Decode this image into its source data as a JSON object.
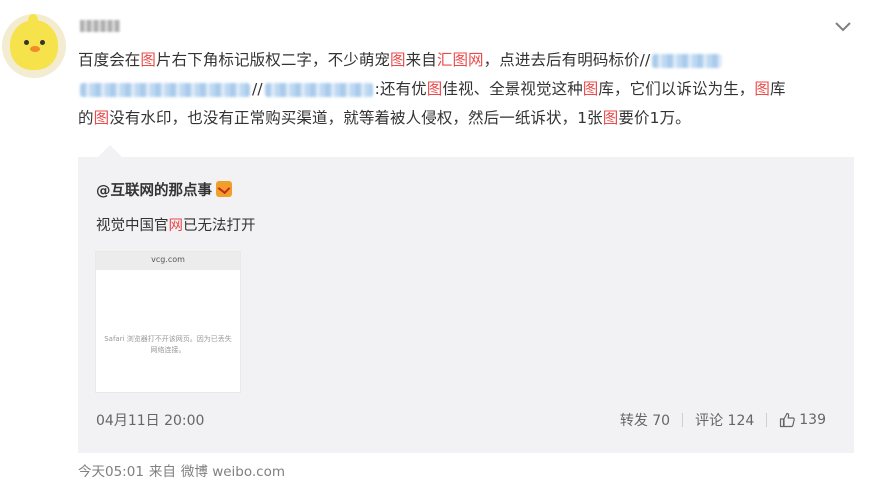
{
  "post": {
    "segments": [
      {
        "t": "百度会在",
        "hl": false
      },
      {
        "t": "图",
        "hl": true
      },
      {
        "t": "片右下角标记版权二字，不少萌宠",
        "hl": false
      },
      {
        "t": "图",
        "hl": true
      },
      {
        "t": "来自",
        "hl": false
      },
      {
        "t": "汇图网",
        "hl": true
      },
      {
        "t": "，点进去后有明码标价//",
        "hl": false
      }
    ],
    "segments2": [
      {
        "t": "//",
        "hl": false
      }
    ],
    "segments3": [
      {
        "t": ":还有优",
        "hl": false
      },
      {
        "t": "图",
        "hl": true
      },
      {
        "t": "佳视、全景视觉这种",
        "hl": false
      },
      {
        "t": "图",
        "hl": true
      },
      {
        "t": "库，它们以诉讼为生，",
        "hl": false
      },
      {
        "t": "图",
        "hl": true
      },
      {
        "t": "库",
        "hl": false
      }
    ],
    "segments4": [
      {
        "t": "的",
        "hl": false
      },
      {
        "t": "图",
        "hl": true
      },
      {
        "t": "没有水印，也没有正常购买渠道，就等着被人侵权，然后一纸诉状，1张",
        "hl": false
      },
      {
        "t": "图",
        "hl": true
      },
      {
        "t": "要价1万。",
        "hl": false
      }
    ]
  },
  "quote": {
    "author": "@互联网的那点事",
    "text_a": "视觉中国官",
    "text_hl": "网",
    "text_b": "已无法打开",
    "thumb_url": "vcg.com",
    "thumb_msg": "Safari 浏览器打不开该网页。因为已丢失网络连接。",
    "date": "04月11日 20:00",
    "repost": "转发 70",
    "comment": "评论 124",
    "likes": "139"
  },
  "footer": {
    "time": "今天05:01",
    "from_label": "来自",
    "source": "微博 weibo.com"
  },
  "colors": {
    "highlight": "#eb4b4b",
    "quote_bg": "#f2f2f5",
    "muted": "#808080"
  },
  "icons": [
    "avatar-chick",
    "chevron-down-icon",
    "verified-v-icon",
    "like-thumb-icon"
  ]
}
